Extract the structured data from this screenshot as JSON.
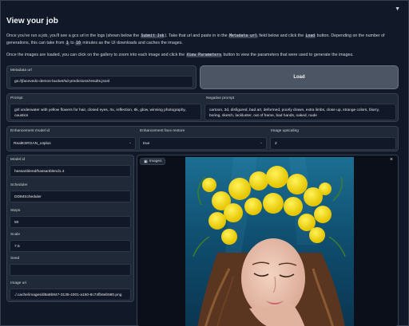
{
  "title": "View your job",
  "intro": {
    "p1_a": "Once you've run a job, you'll see a gcs url in the logs (shown below the ",
    "p1_code1": "Submit Job",
    "p1_b": "). Take that url and paste in in the ",
    "p1_code2": "Metadata url",
    "p1_c": " field below and click the ",
    "p1_code3": "Load",
    "p1_d": " button. Depending on the number of generations, this can take from ",
    "p1_code4": "1",
    "p1_e": " to ",
    "p1_code5": "10",
    "p1_f": " minutes as the UI downloads and caches the images.",
    "p2_a": "Once the images are loaded, you can click on the gallery to zoom into each image and click the ",
    "p2_code": "View Parameters",
    "p2_b": " button to view the parameters that were used to generate the images."
  },
  "metadata": {
    "label": "Metadata url",
    "value": "gs://jfacevedo-demos-bucket/sd-predictions/results.jsonl"
  },
  "load_button": "Load",
  "prompt": {
    "label": "Prompt",
    "value": "girl underwater with yellow flowers for hair, closed eyes, rtx, reflection, 8k, glow, winning photography, caustics"
  },
  "negative_prompt": {
    "label": "Negative prompt",
    "value": "cartoon, 3d, disfigured, bad art, deformed, poorly drawn, extra limbs, close up, strange colors, blurry, boring, sketch, lackluster, out of frame, bad hands, naked, nude"
  },
  "enhancement_model": {
    "label": "Enhancement model id",
    "value": "RealESRGAN_x4plus"
  },
  "face_restore": {
    "label": "Enhancement face restore",
    "value": "true"
  },
  "upscaling": {
    "label": "Image upscaling",
    "value": "2"
  },
  "params": {
    "model_id": {
      "label": "Model id",
      "value": "hassanblend/hassanblend1.4"
    },
    "scheduler": {
      "label": "Scheduler",
      "value": "DDIMScheduler"
    },
    "steps": {
      "label": "Steps",
      "value": "50"
    },
    "scale": {
      "label": "Scale",
      "value": "7.5"
    },
    "seed": {
      "label": "Seed",
      "value": ""
    },
    "image_uri": {
      "label": "Image uri",
      "value": "./.cache/images/d8a9b947-3135-4301-a150-8c74fb6eb580.png"
    }
  },
  "gallery": {
    "label": "Images"
  },
  "icons": {
    "collapse": "triangle-down-icon",
    "close": "close-icon",
    "gallery": "image-icon",
    "chevron": "chevron-down-icon"
  }
}
